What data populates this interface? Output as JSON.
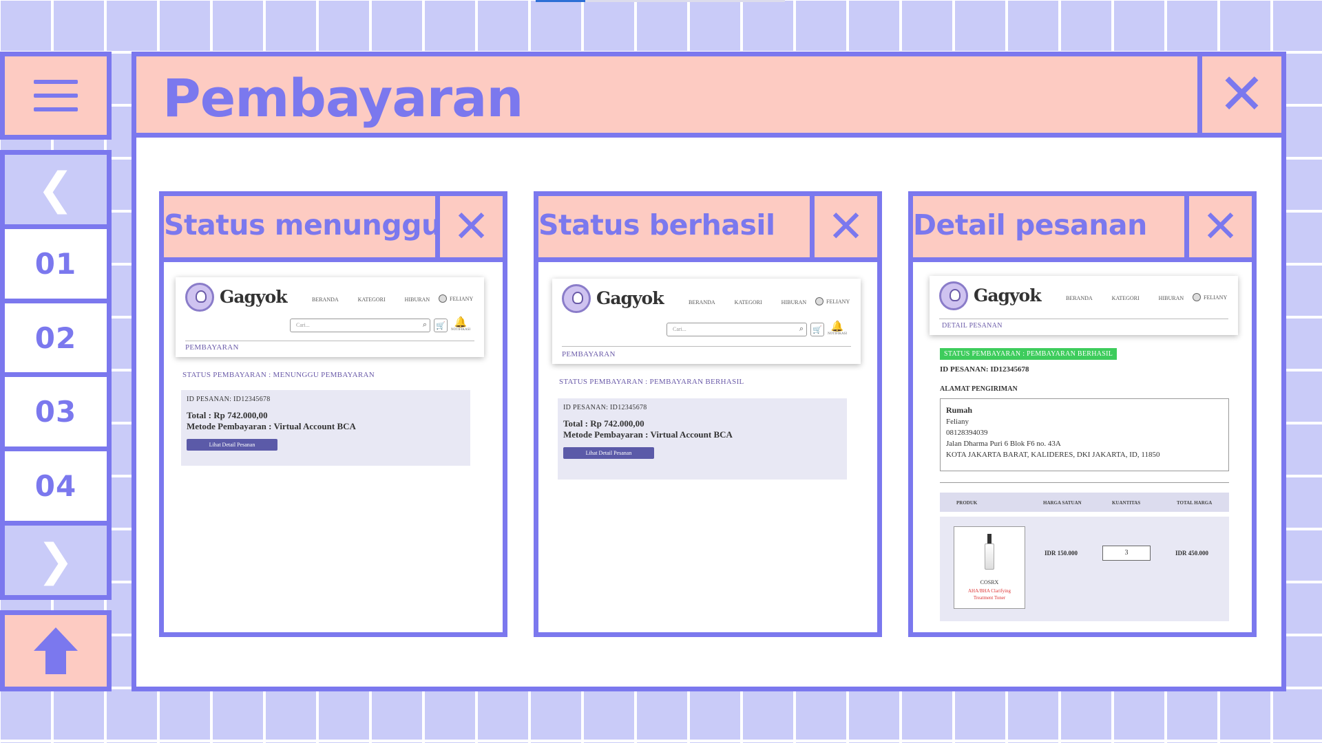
{
  "header": {
    "title": "Pembayaran",
    "close_label": "✕"
  },
  "sidebar": {
    "prev_label": "❮",
    "next_label": "❯",
    "pages": [
      "01",
      "02",
      "03",
      "04"
    ]
  },
  "panels": [
    {
      "title": "Status menunggu",
      "close_label": "✕",
      "site": {
        "brand": "Gagyok",
        "nav": [
          "BERANDA",
          "KATEGORI",
          "HIBURAN"
        ],
        "user": "FELIANY",
        "search_placeholder": "Cari...",
        "notif_label": "NOTIFIKASI",
        "sub_nav": "PEMBAYARAN",
        "status": "STATUS PEMBAYARAN : MENUNGGU PEMBAYARAN",
        "order_id": "ID PESANAN: ID12345678",
        "total": "Total : Rp 742.000,00",
        "method": "Metode Pembayaran : Virtual Account BCA",
        "button": "Lihat Detail Pesanan"
      }
    },
    {
      "title": "Status berhasil",
      "close_label": "✕",
      "site": {
        "brand": "Gagyok",
        "nav": [
          "BERANDA",
          "KATEGORI",
          "HIBURAN"
        ],
        "user": "FELIANY",
        "search_placeholder": "Cari...",
        "notif_label": "NOTIFIKASI",
        "sub_nav": "PEMBAYARAN",
        "status": "STATUS PEMBAYARAN : PEMBAYARAN BERHASIL",
        "order_id": "ID PESANAN: ID12345678",
        "total": "Total : Rp 742.000,00",
        "method": "Metode Pembayaran : Virtual Account BCA",
        "button": "Lihat Detail Pesanan"
      }
    },
    {
      "title": "Detail pesanan",
      "close_label": "✕",
      "site": {
        "brand": "Gagyok",
        "nav": [
          "BERANDA",
          "KATEGORI",
          "HIBURAN"
        ],
        "user": "FELIANY",
        "sub_nav": "DETAIL PESANAN",
        "status_badge": "STATUS PEMBAYARAN : PEMBAYARAN BERHASIL",
        "order_id": "ID PESANAN: ID12345678",
        "address_heading": "ALAMAT PENGIRIMAN",
        "address": {
          "label": "Rumah",
          "name": "Feliany",
          "phone": "08128394039",
          "street": "Jalan Dharma Puri 6 Blok F6 no. 43A",
          "city": "KOTA JAKARTA BARAT, KALIDERES, DKI JAKARTA, ID, 11850"
        },
        "table_headers": [
          "PRODUK",
          "HARGA SATUAN",
          "KUANTITAS",
          "TOTAL HARGA"
        ],
        "product": {
          "brand": "COSRX",
          "name": "AHA/BHA Clarifying Treatment Toner",
          "unit_price": "IDR 150.000",
          "quantity": "3",
          "total_price": "IDR 450.000"
        }
      }
    }
  ],
  "colors": {
    "accent": "#7b78ee",
    "header_bg": "#fdcbc2",
    "grid_bg": "#c9cbf8",
    "success": "#3dcc5c"
  },
  "icons": {
    "menu": "hamburger-icon",
    "up": "arrow-up-icon",
    "close": "close-icon"
  }
}
